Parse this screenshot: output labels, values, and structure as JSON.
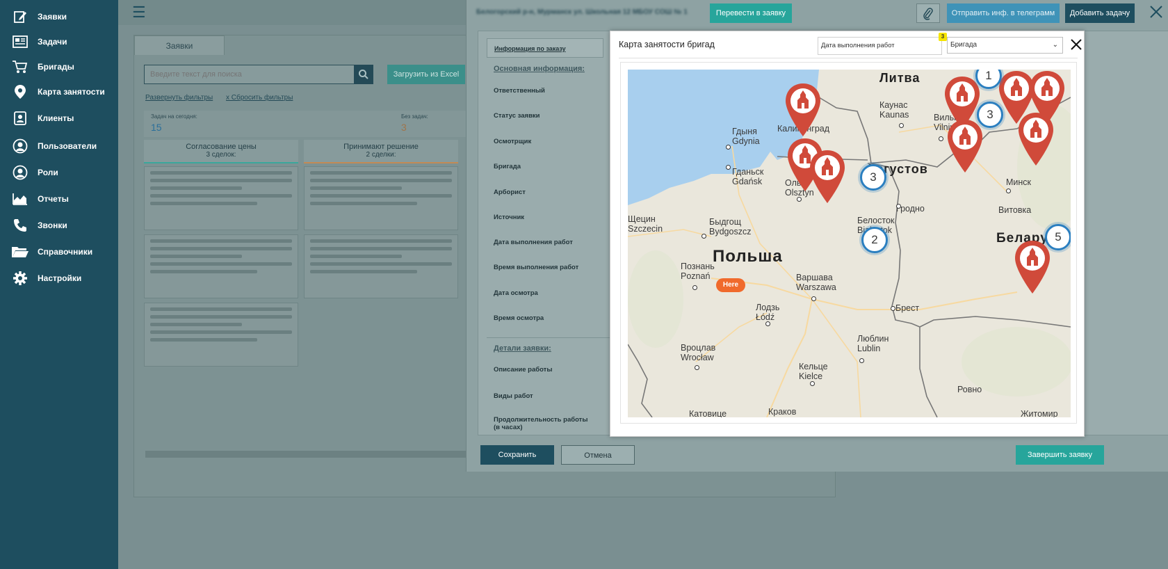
{
  "sidebar": {
    "items": [
      {
        "label": "Заявки",
        "icon": "edit-icon"
      },
      {
        "label": "Задачи",
        "icon": "newspaper-icon"
      },
      {
        "label": "Бригады",
        "icon": "cart-icon"
      },
      {
        "label": "Карта занятости",
        "icon": "map-pin-icon"
      },
      {
        "label": "Клиенты",
        "icon": "contact-card-icon"
      },
      {
        "label": "Пользователи",
        "icon": "user-icon"
      },
      {
        "label": "Роли",
        "icon": "user-role-icon"
      },
      {
        "label": "Отчеты",
        "icon": "area-chart-icon"
      },
      {
        "label": "Звонки",
        "icon": "phone-icon"
      },
      {
        "label": "Справочники",
        "icon": "folder-icon"
      },
      {
        "label": "Настройки",
        "icon": "gear-icon"
      }
    ]
  },
  "board": {
    "tab": "Заявки",
    "search_placeholder": "Введите текст для поиска",
    "excel_button": "Загрузить из Excel",
    "expand_filters": "Развернуть фильтры",
    "reset_filters": "х Сбросить фильтры",
    "today_label": "Задач на сегодня:",
    "today_value": "15",
    "no_tasks_label": "Без задач:",
    "no_tasks_value": "3",
    "columns": [
      {
        "title": "Согласование цены",
        "subtitle": "3 сделок:"
      },
      {
        "title": "Принимают решение",
        "subtitle": "2 сделки:"
      }
    ]
  },
  "side_panel": {
    "transfer_button": "Перевести в заявку",
    "telegram_button": "Отправить инф. в телеграмм",
    "add_task_button": "Добавить задачу",
    "info_tab": "Информация по заказу",
    "section_main": "Основная информация:",
    "section_details": "Детали заявки:",
    "fields": [
      "Ответственный",
      "Статус заявки",
      "Осмотрщик",
      "Бригада",
      "Арборист",
      "Источник",
      "Дата выполнения работ",
      "Время выполнения работ",
      "Дата осмотра",
      "Время осмотра"
    ],
    "detail_fields": [
      "Описание работы",
      "Виды работ",
      "Продолжительность работы (в часах)"
    ],
    "save_button": "Сохранить",
    "cancel_button": "Отмена",
    "finish_button": "Завершить заявку"
  },
  "modal": {
    "title": "Карта занятости бригад",
    "date_placeholder": "Дата выполнения работ",
    "badge": "3",
    "brigade_select": "Бригада"
  },
  "map": {
    "countries": {
      "lithuania": "Литва",
      "poland": "Польша",
      "belarus": "Беларусь"
    },
    "cities": {
      "kaunas": "Каунас\nKaunas",
      "vilnius": "Вильн\nVilniu",
      "kaliningrad": "Калининград",
      "gdynia": "Гдыня\nGdynia",
      "gdansk": "Гданьск\nGdańsk",
      "olsztyn": "Ольш\nOlsztyn",
      "augustow": "Августов",
      "minsk": "Минск",
      "vitebsk": "Витовка",
      "grodno": "Гродно",
      "szczecin": "Щецин\nSzczecin",
      "bydgoszcz": "Быдгощ\nBydgoszcz",
      "bialystok": "Белосток\nBialystok",
      "poznan": "Познань\nPoznań",
      "warsaw": "Варшава\nWarszawa",
      "brest": "Брест",
      "lodz": "Лодзь\nŁódź",
      "lublin": "Люблин\nLublin",
      "wroclaw": "Вроцлав\nWrocław",
      "kielce": "Кельце\nKielce",
      "rovno": "Ровно",
      "krakow": "Краков",
      "katowice": "Катовице",
      "zhytomyr": "Житомир"
    },
    "here_label": "Here",
    "clusters": [
      "1",
      "3",
      "3",
      "2",
      "5"
    ]
  },
  "colors": {
    "sidebar": "#1e4e5f",
    "teal_button": "#27a59b",
    "marker": "#d04a3a",
    "cluster": "#2b7fc0"
  }
}
